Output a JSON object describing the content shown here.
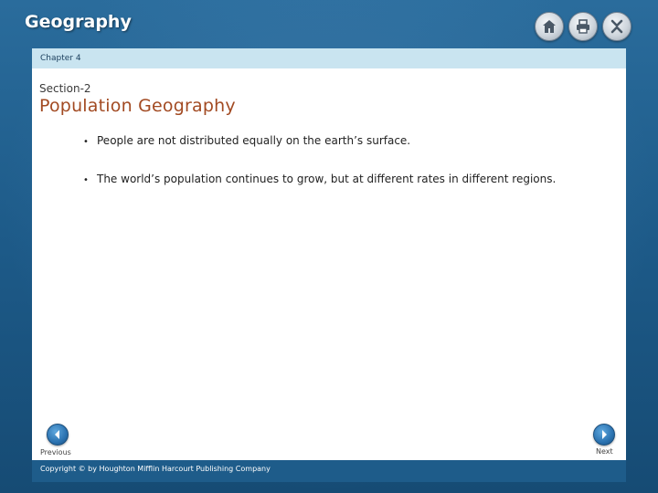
{
  "app": {
    "title": "Geography"
  },
  "toolbar": {
    "home_icon": "home-icon",
    "print_icon": "printer-icon",
    "close_icon": "close-icon",
    "close_label": "X"
  },
  "chapter": {
    "label": "Chapter 4"
  },
  "section": {
    "label": "Section-2",
    "title": "Population Geography"
  },
  "bullets": [
    "People are not distributed equally on the earth’s surface.",
    "The world’s population continues to grow, but at different rates in different regions."
  ],
  "navigation": {
    "previous_label": "Previous",
    "next_label": "Next"
  },
  "footer": {
    "copyright": "Copyright © by Houghton Mifflin Harcourt Publishing Company"
  },
  "colors": {
    "background": "#1f5f8e",
    "chapter_bar": "#c9e4f0",
    "section_title": "#a24a22",
    "nav_button": "#2b72b0"
  }
}
